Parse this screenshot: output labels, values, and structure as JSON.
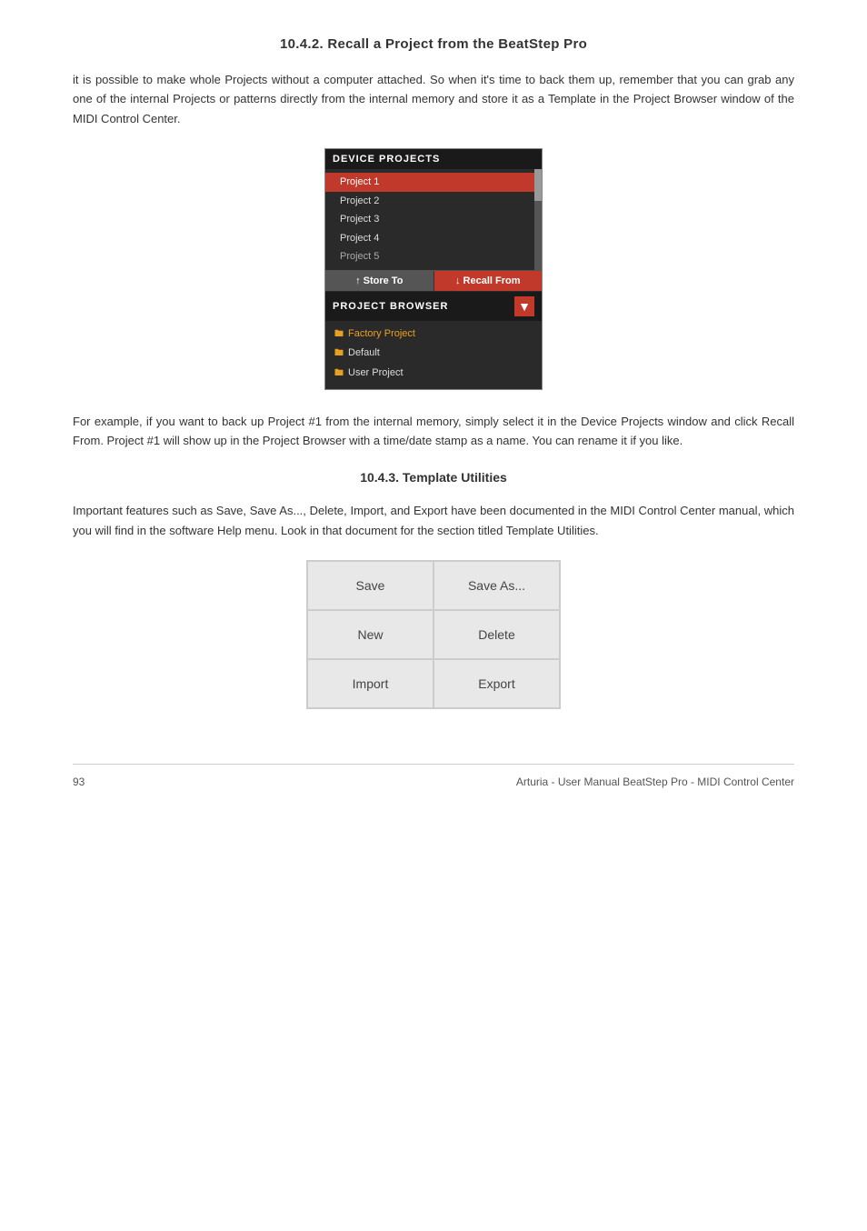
{
  "page": {
    "section1_heading": "10.4.2. Recall a Project from the BeatStep Pro",
    "section1_body1": "it is possible to make whole Projects without a computer attached. So when it's time to back them up, remember that you can grab any one of the internal Projects or patterns directly from the internal memory and store it as a Template in the Project Browser window of the MIDI Control Center.",
    "section1_body2": "For example, if you want to back up Project #1 from the internal memory, simply select it in the Device Projects window and click Recall From. Project #1 will show up in the Project Browser with a time/date stamp as a name. You can rename it if you like.",
    "section2_heading": "10.4.3. Template Utilities",
    "section2_body": "Important features such as Save, Save As..., Delete, Import, and Export have been documented in the MIDI Control Center manual, which you will find in the software Help menu. Look in that document for the section titled Template Utilities.",
    "device_projects": {
      "header": "DEVICE PROJECTS",
      "projects": [
        {
          "label": "Project 1",
          "selected": true
        },
        {
          "label": "Project 2",
          "selected": false
        },
        {
          "label": "Project 3",
          "selected": false
        },
        {
          "label": "Project 4",
          "selected": false
        },
        {
          "label": "Project 5",
          "selected": false
        }
      ],
      "store_btn": "Store To",
      "recall_btn": "Recall From"
    },
    "project_browser": {
      "header": "PROJECT BROWSER",
      "items": [
        {
          "label": "Factory Project",
          "type": "factory"
        },
        {
          "label": "Default",
          "type": "default"
        },
        {
          "label": "User Project",
          "type": "user"
        }
      ]
    },
    "template_utilities": {
      "buttons": [
        {
          "label": "Save",
          "row": 0,
          "col": 0
        },
        {
          "label": "Save As...",
          "row": 0,
          "col": 1
        },
        {
          "label": "New",
          "row": 1,
          "col": 0
        },
        {
          "label": "Delete",
          "row": 1,
          "col": 1
        },
        {
          "label": "Import",
          "row": 2,
          "col": 0
        },
        {
          "label": "Export",
          "row": 2,
          "col": 1
        }
      ]
    },
    "footer": {
      "page_number": "93",
      "title": "Arturia - User Manual BeatStep Pro - MIDI Control Center"
    }
  }
}
